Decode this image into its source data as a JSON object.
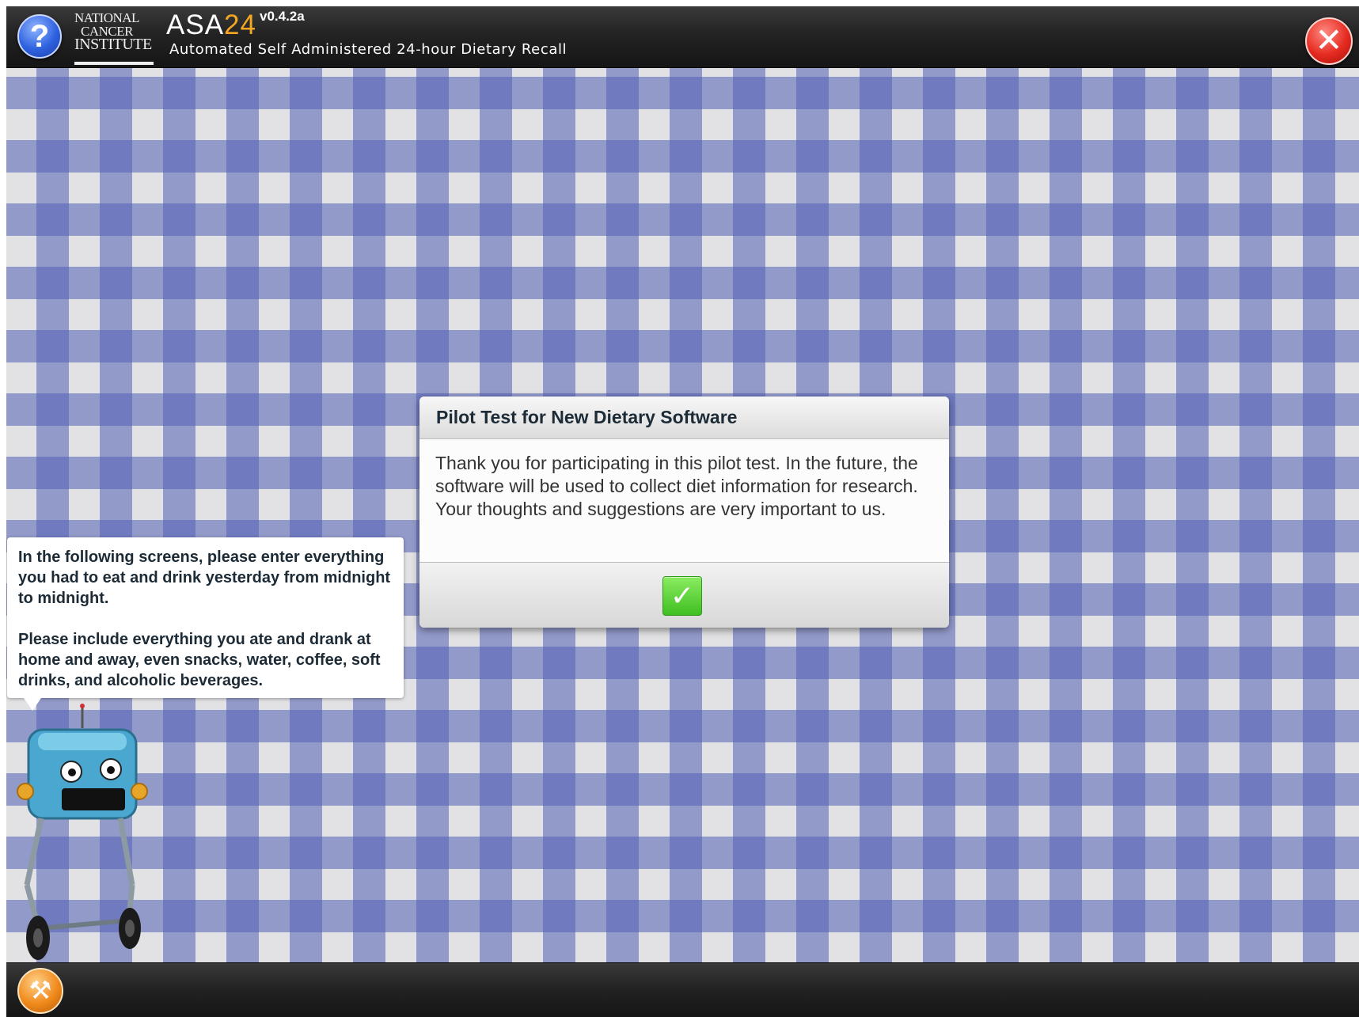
{
  "header": {
    "help_icon": "question-mark-icon",
    "help_glyph": "?",
    "logo_line1": "NATIONAL",
    "logo_line2": "CANCER",
    "logo_line3": "INSTITUTE",
    "app_name_prefix": "ASA",
    "app_name_suffix": "24",
    "version": "v0.4.2a",
    "subtitle": "Automated Self Administered 24-hour Dietary Recall",
    "close_icon": "close-x-icon",
    "close_glyph": "✕"
  },
  "dialog": {
    "title": "Pilot Test for New Dietary Software",
    "body": "Thank you for participating in this pilot test. In the future, the software will be used to collect diet information for research. Your thoughts and suggestions are very important to us.",
    "ok_icon": "checkmark-icon",
    "ok_glyph": "✓"
  },
  "guide": {
    "paragraph1": "In the following screens, please enter everything you had to eat and drink yesterday from midnight to midnight.",
    "paragraph2": "Please include everything you ate and drank at home and away, even snacks, water, coffee, soft drinks, and alcoholic beverages."
  },
  "footer": {
    "tools_icon": "tools-icon",
    "tools_glyph": "⚒"
  },
  "colors": {
    "checker_blue": "#5462b6",
    "checker_light": "#e2e2e4",
    "accent_orange": "#f5a623",
    "ok_green": "#3fbf21",
    "close_red": "#e52b21",
    "help_blue": "#2f62e0"
  }
}
